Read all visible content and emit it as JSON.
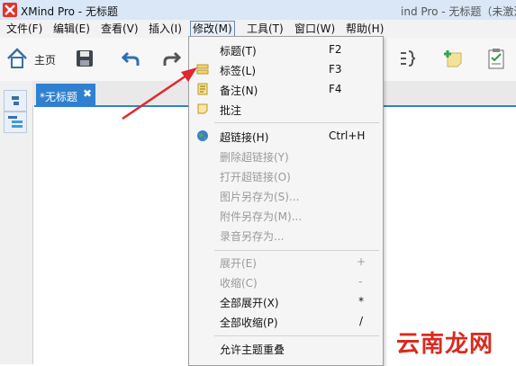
{
  "window": {
    "title": "XMind Pro - 无标题",
    "right_text": "ind Pro - 无标题（未激活）"
  },
  "menubar": [
    {
      "label": "文件(F)"
    },
    {
      "label": "编辑(E)"
    },
    {
      "label": "查看(V)"
    },
    {
      "label": "插入(I)"
    },
    {
      "label": "修改(M)"
    },
    {
      "label": "工具(T)"
    },
    {
      "label": "窗口(W)"
    },
    {
      "label": "帮助(H)"
    }
  ],
  "toolbar": {
    "home_label": "主页"
  },
  "editor": {
    "tab_label": "*无标题",
    "tab_close": "✖"
  },
  "dropdown": {
    "items": [
      {
        "label": "标题(T)",
        "shortcut": "F2"
      },
      {
        "label": "标签(L)",
        "shortcut": "F3"
      },
      {
        "label": "备注(N)",
        "shortcut": "F4"
      },
      {
        "label": "批注",
        "shortcut": ""
      },
      {
        "label": "超链接(H)",
        "shortcut": "Ctrl+H"
      },
      {
        "label": "删除超链接(Y)",
        "shortcut": ""
      },
      {
        "label": "打开超链接(O)",
        "shortcut": ""
      },
      {
        "label": "图片另存为(S)...",
        "shortcut": ""
      },
      {
        "label": "附件另存为(M)...",
        "shortcut": ""
      },
      {
        "label": "录音另存为...",
        "shortcut": ""
      },
      {
        "label": "展开(E)",
        "shortcut": "+"
      },
      {
        "label": "收缩(C)",
        "shortcut": "-"
      },
      {
        "label": "全部展开(X)",
        "shortcut": "*"
      },
      {
        "label": "全部收缩(P)",
        "shortcut": "/"
      },
      {
        "label": "允许主题重叠",
        "shortcut": ""
      }
    ]
  },
  "watermark": {
    "text": "云南龙网"
  },
  "colors": {
    "accent": "#2f80d1",
    "annotation_arrow": "#e0282e",
    "watermark": "#d92b1f"
  }
}
